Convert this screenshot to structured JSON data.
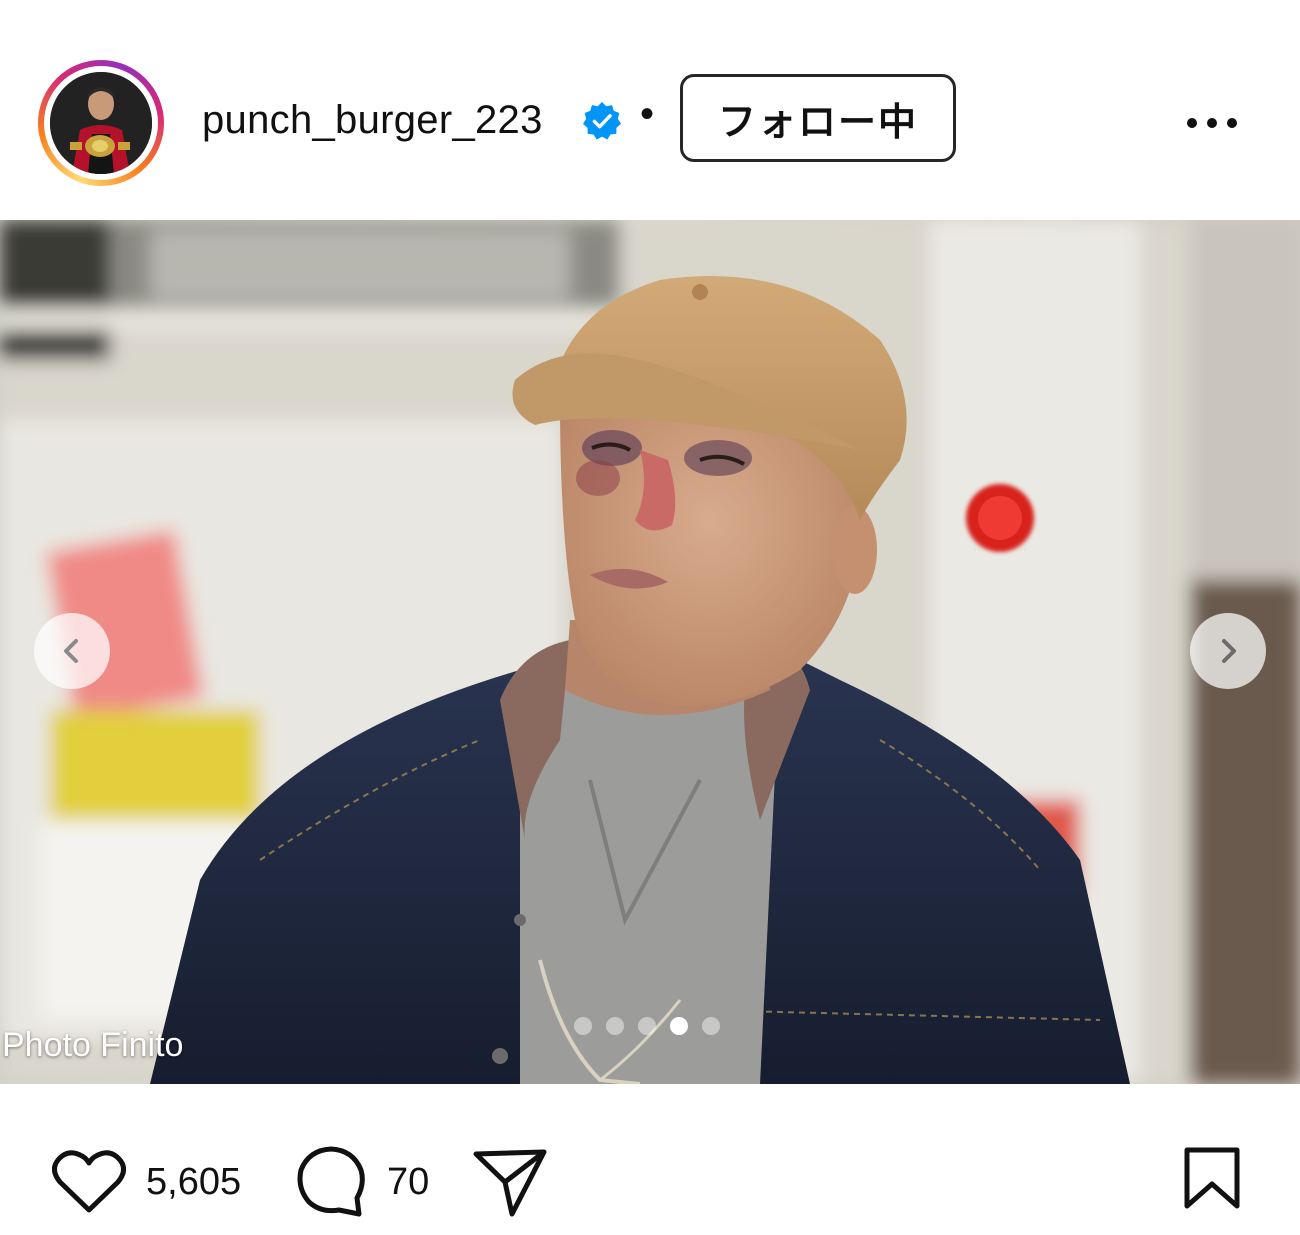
{
  "post": {
    "username": "punch_burger_223",
    "verified_icon": "verified-badge-icon",
    "separator": "•",
    "follow_label": "フォロー中",
    "more_icon": "more-options-icon"
  },
  "photo": {
    "credit": "Photo Finito",
    "carousel": {
      "total": 5,
      "active_index": 3
    },
    "prev_icon": "chevron-left-icon",
    "next_icon": "chevron-right-icon"
  },
  "actions": {
    "likes": "5,605",
    "comments": "70",
    "like_icon": "heart-icon",
    "comment_icon": "comment-icon",
    "share_icon": "send-icon",
    "save_icon": "bookmark-icon"
  },
  "colors": {
    "verified": "#0095f6",
    "ring_gradient": [
      "#feda75",
      "#fa7e1e",
      "#d62976",
      "#962fbf"
    ]
  }
}
